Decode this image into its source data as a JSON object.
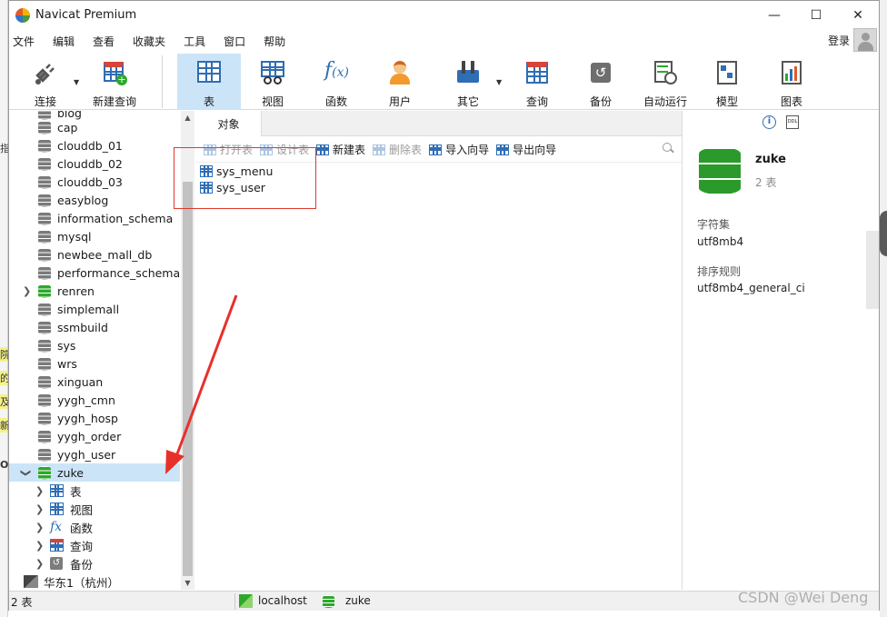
{
  "window": {
    "title": "Navicat Premium",
    "controls": [
      "—",
      "☐",
      "✕"
    ]
  },
  "menu": {
    "items": [
      "文件",
      "编辑",
      "查看",
      "收藏夹",
      "工具",
      "窗口",
      "帮助"
    ],
    "login": "登录"
  },
  "toolbar": {
    "buttons": [
      {
        "label": "连接",
        "icon": "plug-icon"
      },
      {
        "label": "新建查询",
        "icon": "new-query-icon"
      },
      {
        "label": "表",
        "icon": "table-icon",
        "active": true
      },
      {
        "label": "视图",
        "icon": "view-icon"
      },
      {
        "label": "函数",
        "icon": "function-icon"
      },
      {
        "label": "用户",
        "icon": "user-icon"
      },
      {
        "label": "其它",
        "icon": "tools-icon"
      },
      {
        "label": "查询",
        "icon": "query-icon"
      },
      {
        "label": "备份",
        "icon": "backup-icon"
      },
      {
        "label": "自动运行",
        "icon": "automation-icon"
      },
      {
        "label": "模型",
        "icon": "model-icon"
      },
      {
        "label": "图表",
        "icon": "chart-icon"
      }
    ]
  },
  "tree": {
    "partial_top": "blog",
    "databases": [
      "cap",
      "clouddb_01",
      "clouddb_02",
      "clouddb_03",
      "easyblog",
      "information_schema",
      "mysql",
      "newbee_mall_db",
      "performance_schema",
      "renren",
      "simplemall",
      "ssmbuild",
      "sys",
      "wrs",
      "xinguan",
      "yygh_cmn",
      "yygh_hosp",
      "yygh_order",
      "yygh_user",
      "zuke"
    ],
    "selected": "zuke",
    "children": [
      "表",
      "视图",
      "函数",
      "查询",
      "备份"
    ],
    "next_connection": "华东1（杭州）"
  },
  "objects": {
    "tab": "对象",
    "actions": [
      {
        "label": "打开表",
        "enabled": false
      },
      {
        "label": "设计表",
        "enabled": false
      },
      {
        "label": "新建表",
        "enabled": true
      },
      {
        "label": "删除表",
        "enabled": false
      },
      {
        "label": "导入向导",
        "enabled": true
      },
      {
        "label": "导出向导",
        "enabled": true
      }
    ],
    "tables": [
      "sys_menu",
      "sys_user"
    ]
  },
  "info": {
    "name": "zuke",
    "count": "2 表",
    "charset_label": "字符集",
    "charset": "utf8mb4",
    "collation_label": "排序规则",
    "collation": "utf8mb4_general_ci",
    "ddl_tag": "DDL"
  },
  "status": {
    "count": "2 表",
    "connection": "localhost",
    "database": "zuke"
  },
  "watermark": "CSDN @Wei Deng",
  "colors": {
    "selection": "#cce4f7",
    "db_green": "#2da82a",
    "annotation_red": "#e0382e",
    "accent_blue": "#2f6db5"
  }
}
